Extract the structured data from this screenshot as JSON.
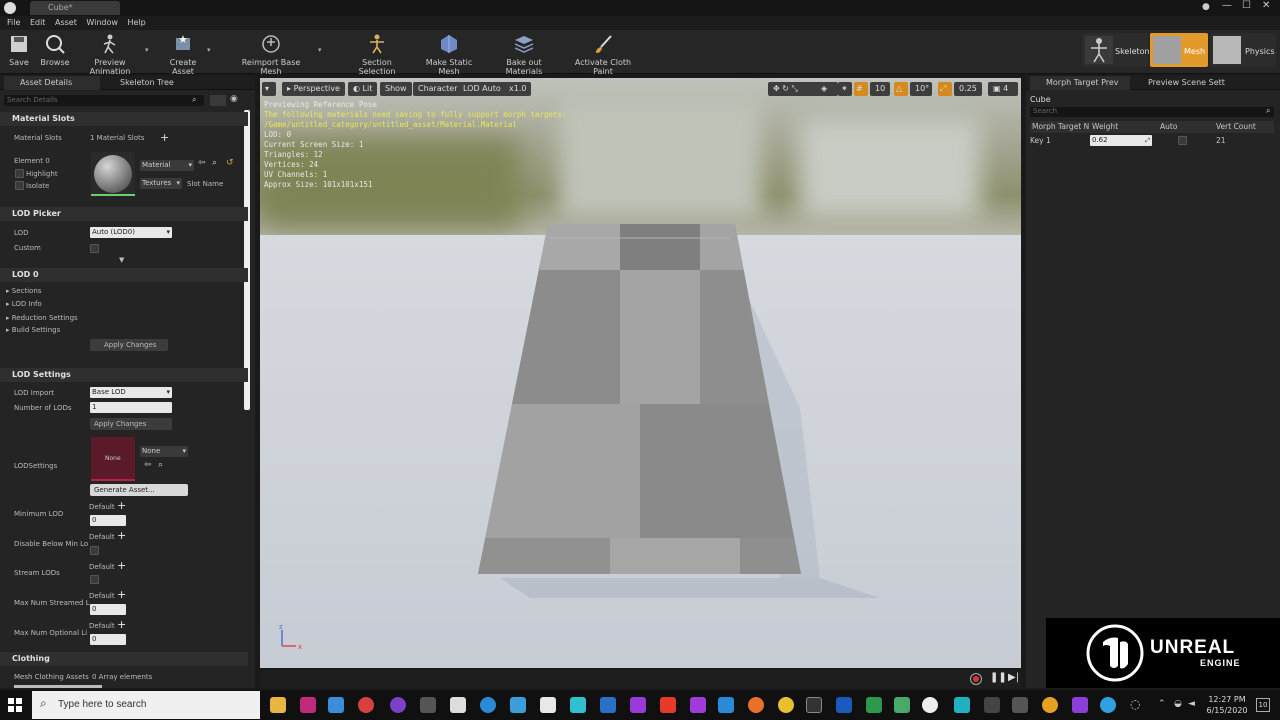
{
  "window": {
    "tab_title": "Cube*"
  },
  "menu": [
    "File",
    "Edit",
    "Asset",
    "Window",
    "Help"
  ],
  "toolbar": {
    "save": "Save",
    "browse": "Browse",
    "preview_animation": "Preview Animation",
    "create_asset": "Create Asset",
    "reimport": "Reimport Base Mesh",
    "section_selection": "Section Selection",
    "make_static_mesh": "Make Static Mesh",
    "bake_out_materials": "Bake out Materials",
    "activate_cloth_paint": "Activate Cloth Paint"
  },
  "modes": {
    "skeleton": "Skeleton",
    "mesh": "Mesh",
    "physics": "Physics"
  },
  "left_tabs": {
    "asset_details": "Asset Details",
    "skeleton_tree": "Skeleton Tree"
  },
  "search_placeholder": "Search Details",
  "material_slots": {
    "header": "Material Slots",
    "label": "Material Slots",
    "count": "1 Material Slots",
    "element": "Element 0",
    "highlight": "Highlight",
    "isolate": "Isolate",
    "material_dd": "Material",
    "textures_dd": "Textures",
    "slot_name": "Slot Name"
  },
  "lod_picker": {
    "header": "LOD Picker",
    "lod_label": "LOD",
    "lod_value": "Auto (LOD0)",
    "custom": "Custom"
  },
  "lod0": {
    "header": "LOD 0",
    "items": [
      "Sections",
      "LOD Info",
      "Reduction Settings",
      "Build Settings"
    ],
    "apply": "Apply Changes"
  },
  "lod_settings": {
    "header": "LOD Settings",
    "lod_import": "LOD Import",
    "lod_import_value": "Base LOD",
    "num_lods": "Number of LODs",
    "num_lods_value": "1",
    "apply": "Apply Changes",
    "lodsettings": "LODSettings",
    "none_thumb": "None",
    "none_dd": "None",
    "generate": "Generate Asset...",
    "min_lod": "Minimum LOD",
    "disable_below": "Disable Below Min Lo",
    "stream_lods": "Stream LODs",
    "max_streamed": "Max Num Streamed L",
    "max_optional": "Max Num Optional Li",
    "default": "Default",
    "zero": "0"
  },
  "clothing": {
    "header": "Clothing",
    "label": "Mesh Clothing Assets",
    "value": "0 Array elements"
  },
  "viewport": {
    "perspective": "Perspective",
    "lit": "Lit",
    "show": "Show",
    "character": "Character",
    "lod_auto": "LOD Auto",
    "speed": "x1.0",
    "grid": "10",
    "angle": "10°",
    "scale": "0.25",
    "cam": "4",
    "stats": [
      {
        "t": "Previewing Reference Pose",
        "w": false
      },
      {
        "t": "The following materials need saving to fully support morph targets:",
        "w": true
      },
      {
        "t": "/Game/untitled_category/untitled_asset/Material.Material",
        "w": true
      },
      {
        "t": "LOD: 0",
        "w": false
      },
      {
        "t": "Current Screen Size: 1",
        "w": false
      },
      {
        "t": "Triangles: 12",
        "w": false
      },
      {
        "t": "Vertices: 24",
        "w": false
      },
      {
        "t": "UV Channels: 1",
        "w": false
      },
      {
        "t": "Approx Size: 101x101x151",
        "w": false
      }
    ]
  },
  "right_tabs": {
    "morph": "Morph Target Prev",
    "scene": "Preview Scene Sett"
  },
  "morph": {
    "object": "Cube",
    "search": "Search",
    "headers": [
      "Morph Target N",
      "Weight",
      "Auto",
      "Vert Count"
    ],
    "row": {
      "name": "Key 1",
      "weight": "0.62",
      "vert": "21"
    }
  },
  "brand": {
    "line1": "UNREAL",
    "line2": "ENGINE"
  },
  "taskbar": {
    "search": "Type here to search",
    "time": "12:27 PM",
    "date": "6/15/2020",
    "notif": "10"
  }
}
